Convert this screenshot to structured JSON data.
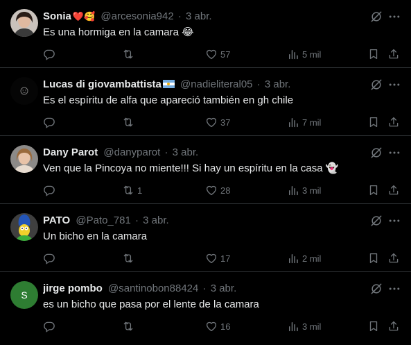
{
  "colors": {
    "background": "#000000",
    "text": "#e7e9ea",
    "muted": "#71767b",
    "divider": "#2f3336"
  },
  "replies": [
    {
      "name": "Sonia",
      "name_emoji": "❤️🥰",
      "handle": "@arcesonia942",
      "date": "3 abr.",
      "text": "Es una hormiga en la camara 😂",
      "replies": "",
      "retweets": "",
      "likes": "57",
      "views": "5 mil",
      "avatar": "photo-woman-icon"
    },
    {
      "name": "Lucas di giovambattista",
      "name_emoji": "🇦🇷",
      "handle": "@nadieliteral05",
      "date": "3 abr.",
      "text": "Es el espíritu de alfa que apareció también en gh chile",
      "replies": "",
      "retweets": "",
      "likes": "37",
      "views": "7 mil",
      "avatar": "dark-smiley-icon"
    },
    {
      "name": "Dany Parot",
      "name_emoji": "",
      "handle": "@danyparot",
      "date": "3 abr.",
      "text": "Ven que la Pincoya no miente!!! Si hay un espíritu en la casa 👻",
      "replies": "",
      "retweets": "1",
      "likes": "28",
      "views": "3 mil",
      "avatar": "photo-woman-icon"
    },
    {
      "name": "PATO",
      "name_emoji": "",
      "handle": "@Pato_781",
      "date": "3 abr.",
      "text": "Un bicho en la camara",
      "replies": "",
      "retweets": "",
      "likes": "17",
      "views": "2 mil",
      "avatar": "cartoon-character-icon"
    },
    {
      "name": "jirge pombo",
      "name_emoji": "",
      "handle": "@santinobon88424",
      "date": "3 abr.",
      "text": "es un bicho que pasa por el lente de la camara",
      "replies": "",
      "retweets": "",
      "likes": "16",
      "views": "3 mil",
      "avatar": "letter-avatar-icon",
      "avatar_letter": "S",
      "avatar_color": "#2e7d32"
    }
  ],
  "sep": "·"
}
